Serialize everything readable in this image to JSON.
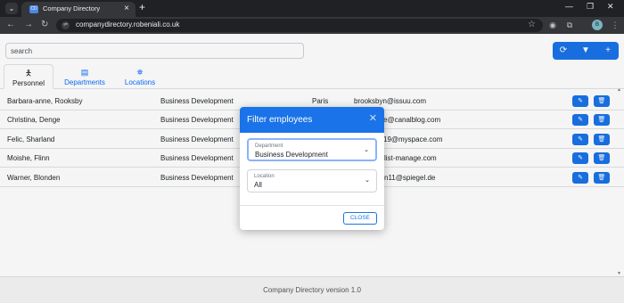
{
  "browser": {
    "tab_title": "Company Directory",
    "favicon_text": "CD",
    "url": "companydirectory.robeniali.co.uk",
    "avatar_letter": "B"
  },
  "search": {
    "placeholder": "search"
  },
  "tabs": [
    {
      "label": "Personnel",
      "icon": "person-icon"
    },
    {
      "label": "Departments",
      "icon": "building-icon"
    },
    {
      "label": "Locations",
      "icon": "locations-icon"
    }
  ],
  "personnel": [
    {
      "name": "Barbara-anne, Rooksby",
      "department": "Business Development",
      "location": "Paris",
      "email": "brooksbyn@issuu.com"
    },
    {
      "name": "Christina, Denge",
      "department": "Business Development",
      "location": "",
      "email": "e@canalblog.com"
    },
    {
      "name": "Felic, Sharland",
      "department": "Business Development",
      "location": "",
      "email": "19@myspace.com"
    },
    {
      "name": "Moishe, Flinn",
      "department": "Business Development",
      "location": "",
      "email": "list-manage.com"
    },
    {
      "name": "Warner, Blonden",
      "department": "Business Development",
      "location": "",
      "email": "n11@spiegel.de"
    }
  ],
  "footer": {
    "text": "Company Directory version 1.0"
  },
  "modal": {
    "title": "Filter employees",
    "department": {
      "label": "Department",
      "value": "Business Development"
    },
    "location": {
      "label": "Location",
      "value": "All"
    },
    "close_label": "CLOSE"
  },
  "colors": {
    "primary": "#1a73e8",
    "browser_dark": "#202124",
    "browser_toolbar": "#35363a"
  }
}
